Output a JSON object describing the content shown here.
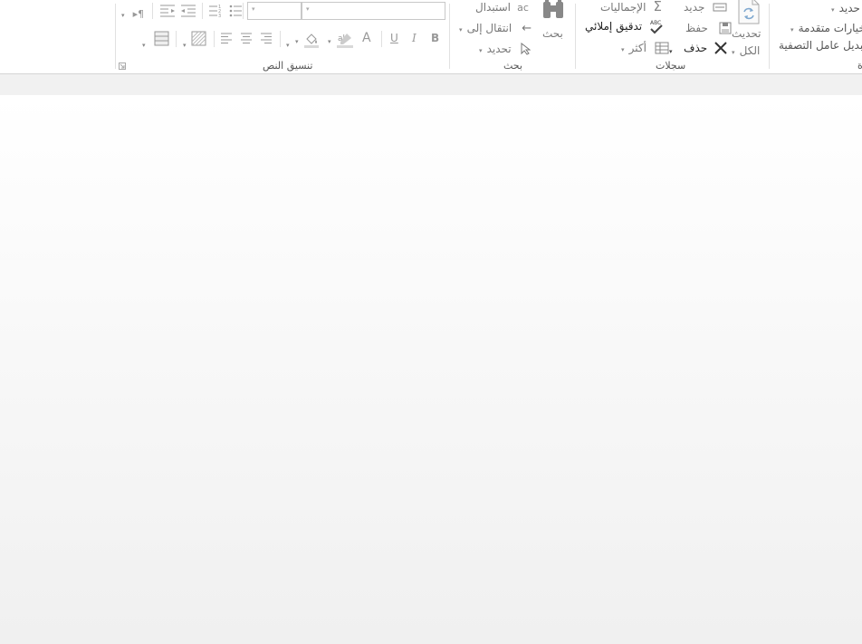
{
  "ribbon": {
    "filter_group": {
      "label_partial": "ة",
      "top_item": "حديد",
      "advanced_options": "خيارات متقدمة",
      "toggle_filter": "تبديل عامل التصفية"
    },
    "records_group": {
      "label": "سجلات",
      "refresh_all_line1": "تحديث",
      "refresh_all_line2": "الكل",
      "new": "جديد",
      "save": "حفظ",
      "delete": "حذف",
      "totals": "الإجماليات",
      "spelling": "تدقيق إملائي",
      "more": "أكثر"
    },
    "find_group": {
      "label": "بحث",
      "find": "بحث",
      "replace": "استبدال",
      "goto": "انتقال إلى",
      "select": "تحديد"
    },
    "text_format_group": {
      "label": "تنسيق النص",
      "bold": "B",
      "italic": "I",
      "underline": "U",
      "font_color": "A"
    }
  },
  "icons": {
    "caret": "▾",
    "more_caret": "▾"
  }
}
